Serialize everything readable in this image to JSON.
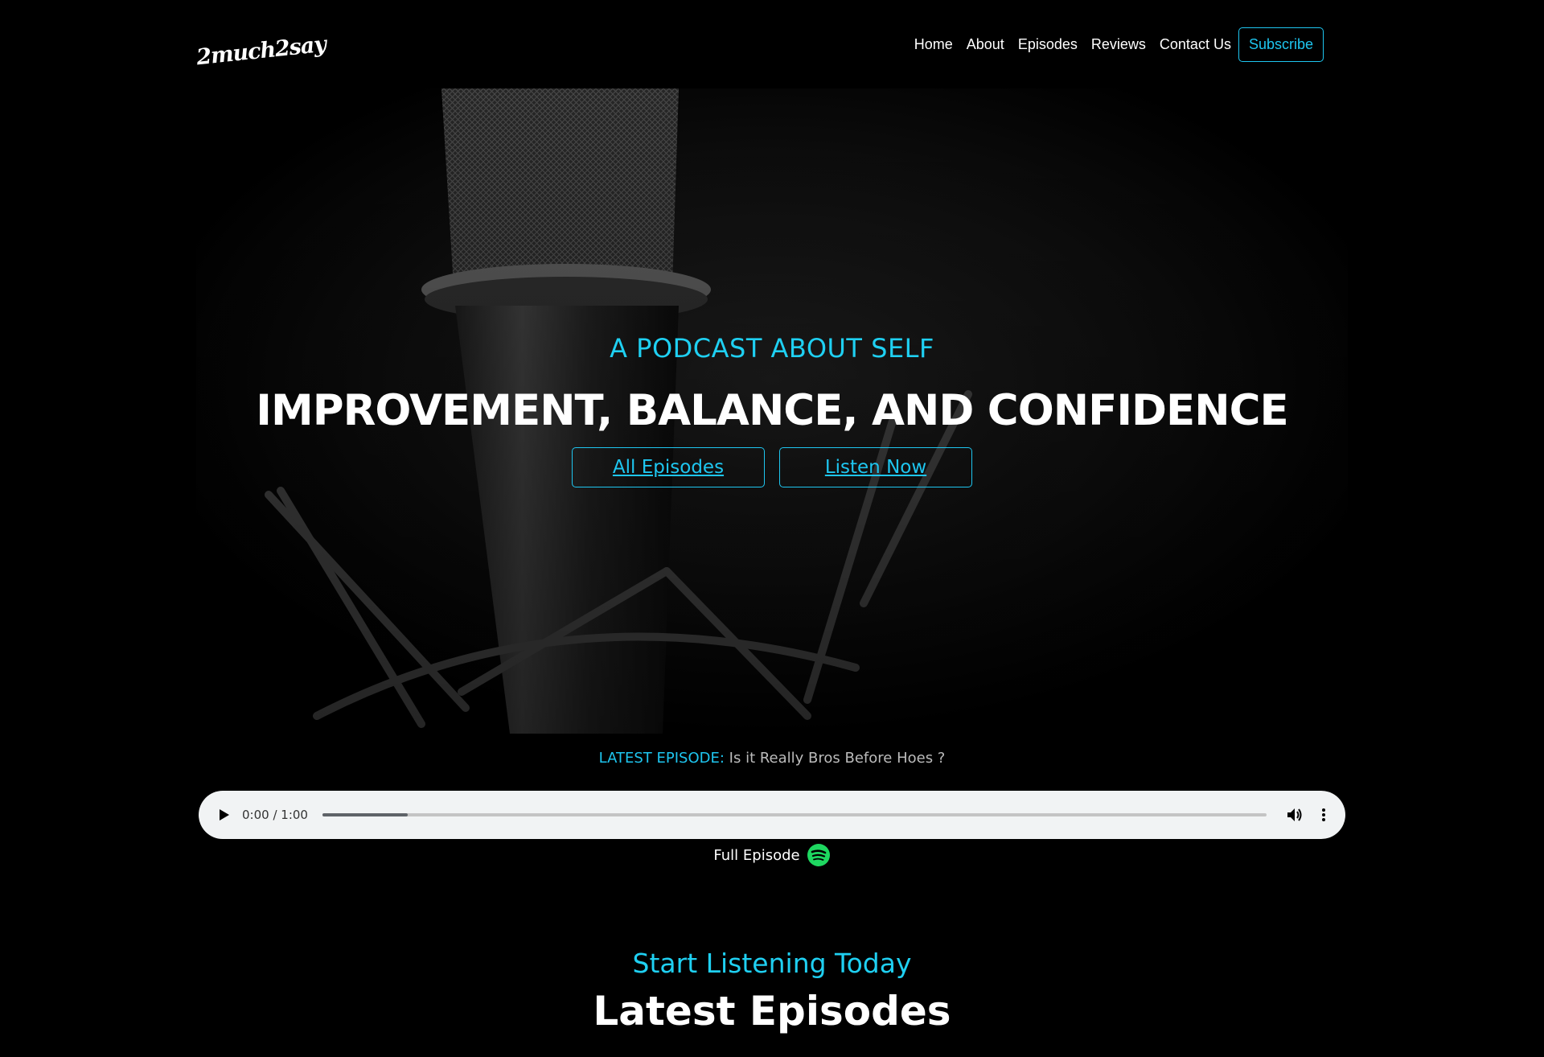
{
  "header": {
    "logo_text": "2much2say",
    "nav": {
      "home": "Home",
      "about": "About",
      "episodes": "Episodes",
      "reviews": "Reviews",
      "contact": "Contact Us",
      "subscribe": "Subscribe"
    }
  },
  "hero": {
    "tagline": "A PODCAST ABOUT SELF",
    "title": "IMPROVEMENT, BALANCE, AND CONFIDENCE",
    "all_episodes": "All Episodes",
    "listen_now": "Listen Now"
  },
  "latest": {
    "label": "LATEST EPISODE:",
    "title": "Is it Really Bros Before Hoes ?"
  },
  "player": {
    "time": "0:00 / 1:00",
    "buffered_fraction": 0.09
  },
  "full_episode": {
    "label": "Full Episode",
    "icon": "spotify-icon"
  },
  "section": {
    "subtitle": "Start Listening Today",
    "title": "Latest Episodes"
  },
  "colors": {
    "accent": "#1ec6f0",
    "background": "#000000",
    "spotify": "#1ed760"
  }
}
